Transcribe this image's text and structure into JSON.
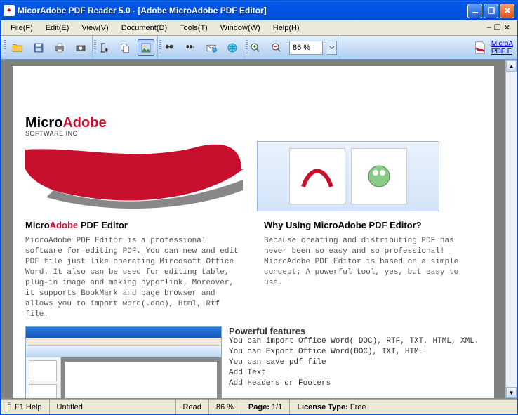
{
  "window": {
    "title": "MicorAdobe PDF Reader 5.0 - [Adobe MicroAdobe PDF Editor]"
  },
  "menu": {
    "file": "File(F)",
    "edit": "Edit(E)",
    "view": "View(V)",
    "document": "Document(D)",
    "tools": "Tools(T)",
    "window": "Window(W)",
    "help": "Help(H)"
  },
  "toolbar": {
    "zoom_value": "86 %"
  },
  "sidepanel": {
    "link1": "MicroA",
    "link2": "PDF E"
  },
  "doc": {
    "brand1": "Micro",
    "brand2": "Adobe",
    "brand_sub": "SOFTWARE INC",
    "h_left_1": "Micro",
    "h_left_2": "Adobe",
    "h_left_3": " PDF Editor",
    "h_right": "Why Using MicroAdobe PDF Editor?",
    "p_left": "MicroAdobe PDF Editor is a professional software for editing PDF. You can new and edit PDF file just like operating Mircosoft Office Word. It also can be used for editing table, plug-in image and making hyperlink. Moreover, it supports BookMark and page browser and allows you to import word(.doc), Html, Rtf file.",
    "p_right": "Because creating and distributing PDF has never been so easy and so professional! MicroAdobe PDF Editor is based on a simple concept: A powerful tool, yes, but easy to use.",
    "feat_h": "Powerful features",
    "feat_1": " You can import Office Word( DOC), RTF, TXT, HTML, XML.",
    "feat_2": " You can Export Office Word(DOC), TXT, HTML",
    "feat_3": " You can save pdf file",
    "feat_4": " Add Text",
    "feat_5": " Add Headers or Footers"
  },
  "status": {
    "help": "F1 Help",
    "docname": "Untitled",
    "mode": "Read",
    "zoom": "86 %",
    "page_label": "Page:",
    "page_val": "1/1",
    "lic_label": "License Type:",
    "lic_val": "Free"
  }
}
